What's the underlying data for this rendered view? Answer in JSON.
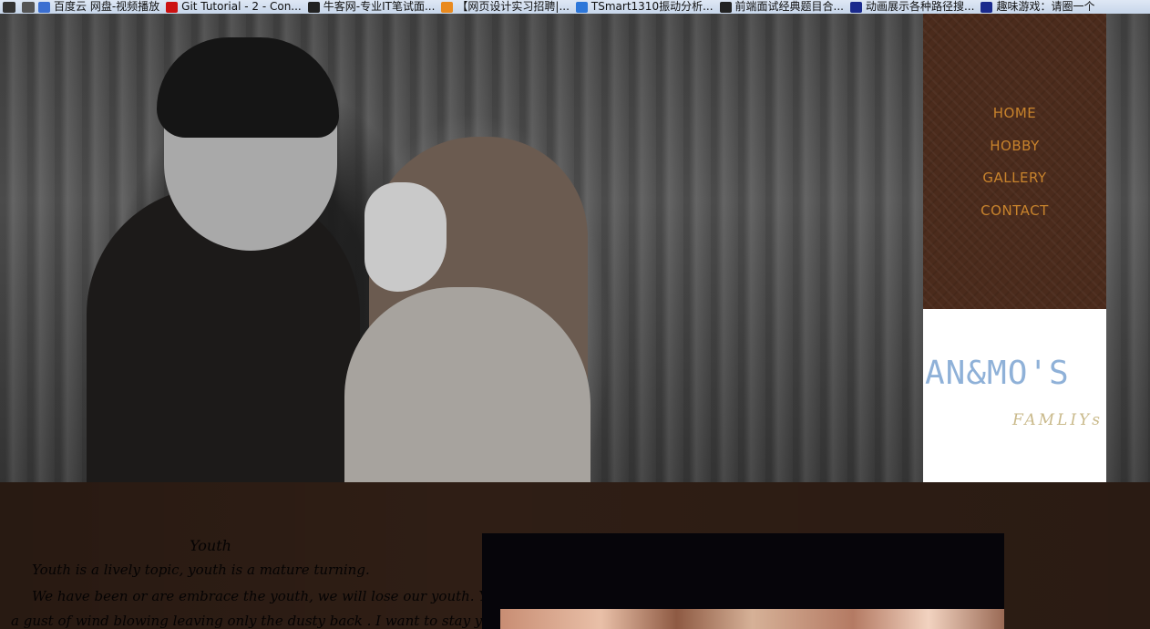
{
  "bookmarks": [
    {
      "label": "百度云 网盘-视频播放",
      "icon": "infinity-icon",
      "color": "#3b6fd1"
    },
    {
      "label": "Git Tutorial - 2 - Con...",
      "icon": "youtube-icon",
      "color": "#cc1111"
    },
    {
      "label": "牛客网-专业IT笔试面...",
      "icon": "newcoder-icon",
      "color": "#222222"
    },
    {
      "label": "【网页设计实习招聘|...",
      "icon": "firefox-icon",
      "color": "#e98a1f"
    },
    {
      "label": "TSmart1310振动分析...",
      "icon": "shield-icon",
      "color": "#2d77d9"
    },
    {
      "label": "前端面试经典题目合...",
      "icon": "newcoder-icon",
      "color": "#222222"
    },
    {
      "label": "动画展示各种路径搜...",
      "icon": "flag-icon",
      "color": "#1a2a8c"
    },
    {
      "label": "趣味游戏：请圈一个",
      "icon": "flag-icon",
      "color": "#1a2a8c"
    }
  ],
  "nav": {
    "items": [
      "HOME",
      "HOBBY",
      "GALLERY",
      "CONTACT"
    ],
    "text_color": "#c8832c",
    "background": "#4b2b1c"
  },
  "logo": {
    "title": "AN&MO'S",
    "subtitle": "FAMLIYs",
    "title_color": "#8fb1d8",
    "subtitle_color": "#c9b98a"
  },
  "article": {
    "title": "Youth",
    "lines": [
      "Youth is a lively topic, youth is a mature turning.",
      "We have been or are embrace the youth, we will lose our youth. Youth is like",
      "a gust of wind blowing leaving only the dusty back . I want to stay young , but"
    ]
  }
}
